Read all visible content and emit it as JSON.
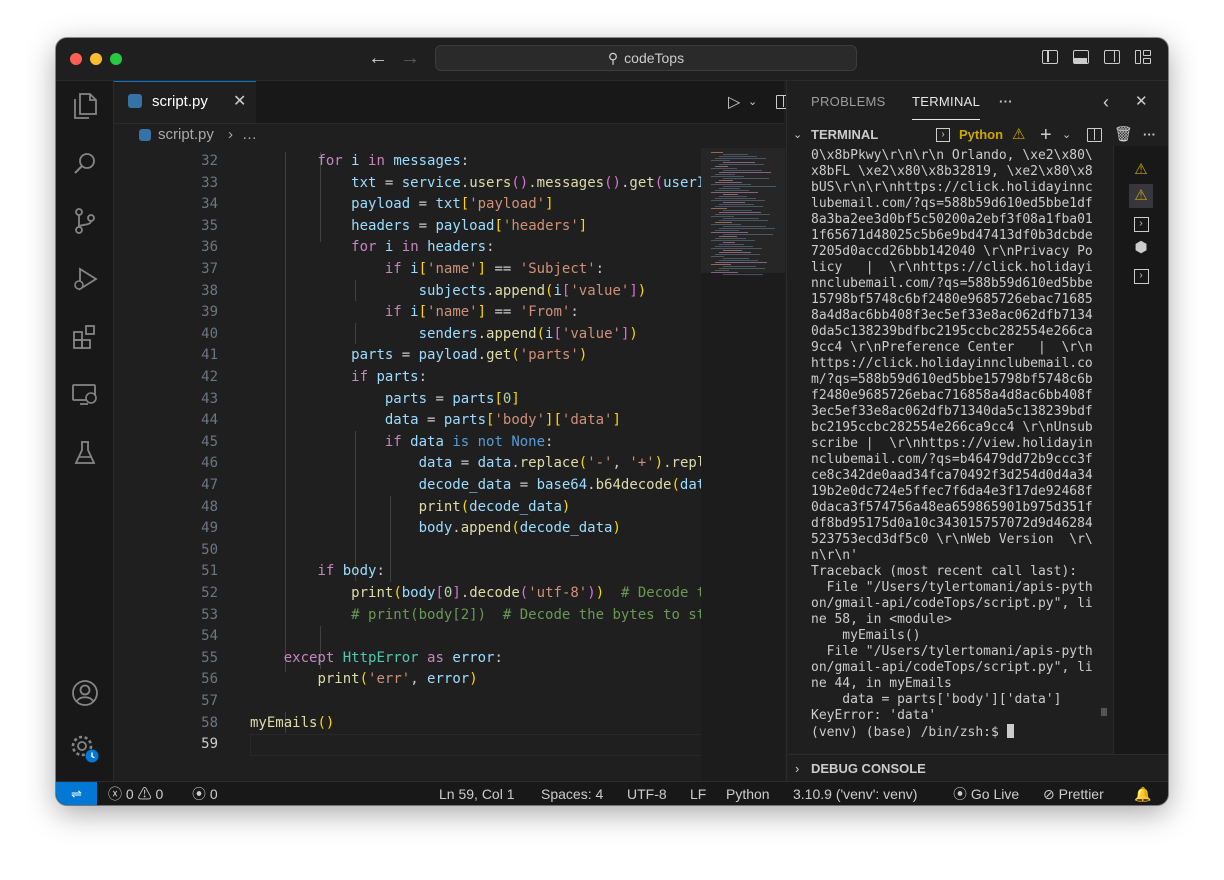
{
  "titlebar": {
    "search_text": "codeTops"
  },
  "editor": {
    "tab_label": "script.py",
    "breadcrumb_file": "script.py",
    "breadcrumb_more": "…",
    "line_numbers": [
      "32",
      "33",
      "34",
      "35",
      "36",
      "37",
      "38",
      "39",
      "40",
      "41",
      "42",
      "43",
      "44",
      "45",
      "46",
      "47",
      "48",
      "49",
      "50",
      "51",
      "52",
      "53",
      "54",
      "55",
      "56",
      "57",
      "58",
      "59"
    ]
  },
  "panel": {
    "tab_problems": "PROBLEMS",
    "tab_terminal": "TERMINAL",
    "section_title": "TERMINAL",
    "shell_name": "Python",
    "debug_console": "DEBUG CONSOLE",
    "terminal_lines": [
      "0\\x8bPkwy\\r\\n\\r\\n Orlando, \\xe2\\x80\\",
      "x8bFL \\xe2\\x80\\x8b32819, \\xe2\\x80\\x8",
      "bUS\\r\\n\\r\\nhttps://click.holidayinnc",
      "lubemail.com/?qs=588b59d610ed5bbe1df",
      "8a3ba2ee3d0bf5c50200a2ebf3f08a1fba01",
      "1f65671d48025c5b6e9bd47413df0b3dcbde",
      "7205d0accd26bbb142040 \\r\\nPrivacy Po",
      "licy   |  \\r\\nhttps://click.holidayi",
      "nnclubemail.com/?qs=588b59d610ed5bbe",
      "15798bf5748c6bf2480e9685726ebac71685",
      "8a4d8ac6bb408f3ec5ef33e8ac062dfb7134",
      "0da5c138239bdfbc2195ccbc282554e266ca",
      "9cc4 \\r\\nPreference Center   |  \\r\\n",
      "https://click.holidayinnclubemail.co",
      "m/?qs=588b59d610ed5bbe15798bf5748c6b",
      "f2480e9685726ebac716858a4d8ac6bb408f",
      "3ec5ef33e8ac062dfb71340da5c138239bdf",
      "bc2195ccbc282554e266ca9cc4 \\r\\nUnsub",
      "scribe |  \\r\\nhttps://view.holidayin",
      "nclubemail.com/?qs=b46479dd72b9ccc3f",
      "ce8c342de0aad34fca70492f3d254d0d4a34",
      "19b2e0dc724e5ffec7f6da4e3f17de92468f",
      "0daca3f574756a48ea659865901b975d351f",
      "df8bd95175d0a10c343015757072d9d46284",
      "523753ecd3df5c0 \\r\\nWeb Version  \\r\\",
      "n\\r\\n'",
      "Traceback (most recent call last):",
      "  File \"/Users/tylertomani/apis-pyth",
      "on/gmail-api/codeTops/script.py\", li",
      "ne 58, in <module>",
      "    myEmails()",
      "  File \"/Users/tylertomani/apis-pyth",
      "on/gmail-api/codeTops/script.py\", li",
      "ne 44, in myEmails",
      "    data = parts['body']['data']",
      "KeyError: 'data'",
      "(venv) (base) /bin/zsh:$ "
    ]
  },
  "statusbar": {
    "errors": "0",
    "warnings": "0",
    "ports": "0",
    "position": "Ln 59, Col 1",
    "spaces": "Spaces: 4",
    "encoding": "UTF-8",
    "eol": "LF",
    "language": "Python",
    "interpreter": "3.10.9 ('venv': venv)",
    "go_live": "Go Live",
    "prettier": "Prettier"
  },
  "colors": {
    "accent": "#0078d4",
    "warning": "#cca700",
    "editor_bg": "#1f1f1f"
  }
}
